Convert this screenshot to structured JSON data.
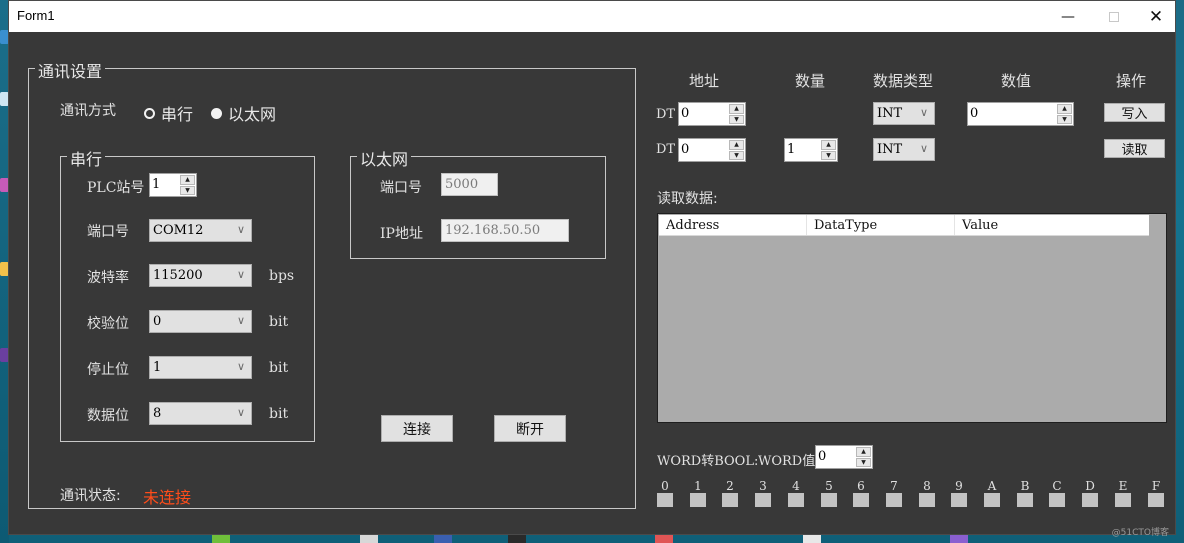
{
  "window": {
    "title": "Form1",
    "minimize_icon": "minimize-icon",
    "maximize_icon": "maximize-icon",
    "close_icon": "close-icon"
  },
  "comm_settings": {
    "group_title": "通讯设置",
    "mode_label": "通讯方式",
    "mode_options": [
      {
        "label": "串行",
        "selected": false
      },
      {
        "label": "以太网",
        "selected": true
      }
    ],
    "serial": {
      "group_title": "串行",
      "station_label": "PLC站号",
      "station_value": "1",
      "port_label": "端口号",
      "port_value": "COM12",
      "baud_label": "波特率",
      "baud_value": "115200",
      "baud_unit": "bps",
      "parity_label": "校验位",
      "parity_value": "0",
      "parity_unit": "bit",
      "stop_label": "停止位",
      "stop_value": "1",
      "stop_unit": "bit",
      "data_label": "数据位",
      "data_value": "8",
      "data_unit": "bit"
    },
    "ethernet": {
      "group_title": "以太网",
      "port_label": "端口号",
      "port_value": "5000",
      "ip_label": "IP地址",
      "ip_value": "192.168.50.50"
    },
    "connect_label": "连接",
    "disconnect_label": "断开",
    "status_label": "通讯状态:",
    "status_value": "未连接",
    "status_color": "#ff4d1a"
  },
  "rw": {
    "headers": {
      "address": "地址",
      "count": "数量",
      "data_type": "数据类型",
      "value": "数值",
      "action": "操作"
    },
    "write_row": {
      "prefix": "DT",
      "address": "0",
      "data_type": "INT",
      "value": "0",
      "button": "写入"
    },
    "read_row": {
      "prefix": "DT",
      "address": "0",
      "count": "1",
      "data_type": "INT",
      "button": "读取"
    },
    "read_data_label": "读取数据:",
    "table_columns": [
      "Address",
      "DataType",
      "Value"
    ],
    "table_rows": []
  },
  "word_bool": {
    "label": "WORD转BOOL:",
    "word_label": "WORD值",
    "word_value": "0",
    "bits": [
      "0",
      "1",
      "2",
      "3",
      "4",
      "5",
      "6",
      "7",
      "8",
      "9",
      "A",
      "B",
      "C",
      "D",
      "E",
      "F"
    ]
  },
  "watermark": "@51CTO博客"
}
